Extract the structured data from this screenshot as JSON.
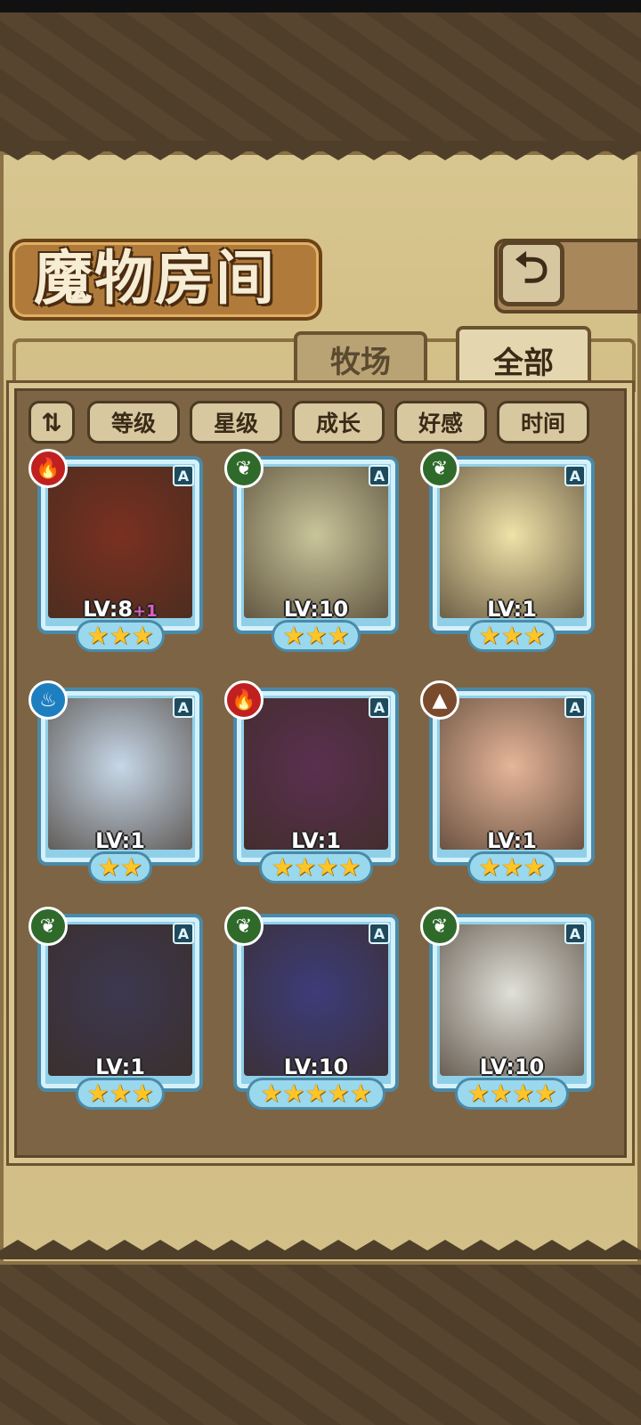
{
  "title": "魔物房间",
  "back_button_icon": "⮌",
  "tabs": [
    {
      "label": "牧场",
      "active": false
    },
    {
      "label": "全部",
      "active": true
    }
  ],
  "sort": {
    "toggle_icon": "⇅",
    "buttons": [
      "等级",
      "星级",
      "成长",
      "好感",
      "时间"
    ]
  },
  "monsters": [
    {
      "element": "fire",
      "rank": "A",
      "level": "LV:8",
      "bonus": "+1",
      "stars": 3,
      "portrait_color": "#7a3020"
    },
    {
      "element": "nature",
      "rank": "A",
      "level": "LV:10",
      "bonus": "",
      "stars": 3,
      "portrait_color": "#c9c59a"
    },
    {
      "element": "nature",
      "rank": "A",
      "level": "LV:1",
      "bonus": "",
      "stars": 3,
      "portrait_color": "#f0e2a8"
    },
    {
      "element": "water",
      "rank": "A",
      "level": "LV:1",
      "bonus": "",
      "stars": 2,
      "portrait_color": "#c6d7e8"
    },
    {
      "element": "fire",
      "rank": "A",
      "level": "LV:1",
      "bonus": "",
      "stars": 4,
      "portrait_color": "#5a3050"
    },
    {
      "element": "earth",
      "rank": "A",
      "level": "LV:1",
      "bonus": "",
      "stars": 3,
      "portrait_color": "#e5b598"
    },
    {
      "element": "nature",
      "rank": "A",
      "level": "LV:1",
      "bonus": "",
      "stars": 3,
      "portrait_color": "#3c3850"
    },
    {
      "element": "nature",
      "rank": "A",
      "level": "LV:10",
      "bonus": "",
      "stars": 5,
      "portrait_color": "#3d3c7a"
    },
    {
      "element": "nature",
      "rank": "A",
      "level": "LV:10",
      "bonus": "",
      "stars": 4,
      "portrait_color": "#e0e0d8"
    }
  ],
  "colors": {
    "fire": "#c02020",
    "nature": "#2f6a2a",
    "water": "#1d7fc0",
    "earth": "#7a4a2c"
  },
  "element_icons": {
    "fire": "🔥",
    "nature": "❦",
    "water": "♨",
    "earth": "▲"
  }
}
